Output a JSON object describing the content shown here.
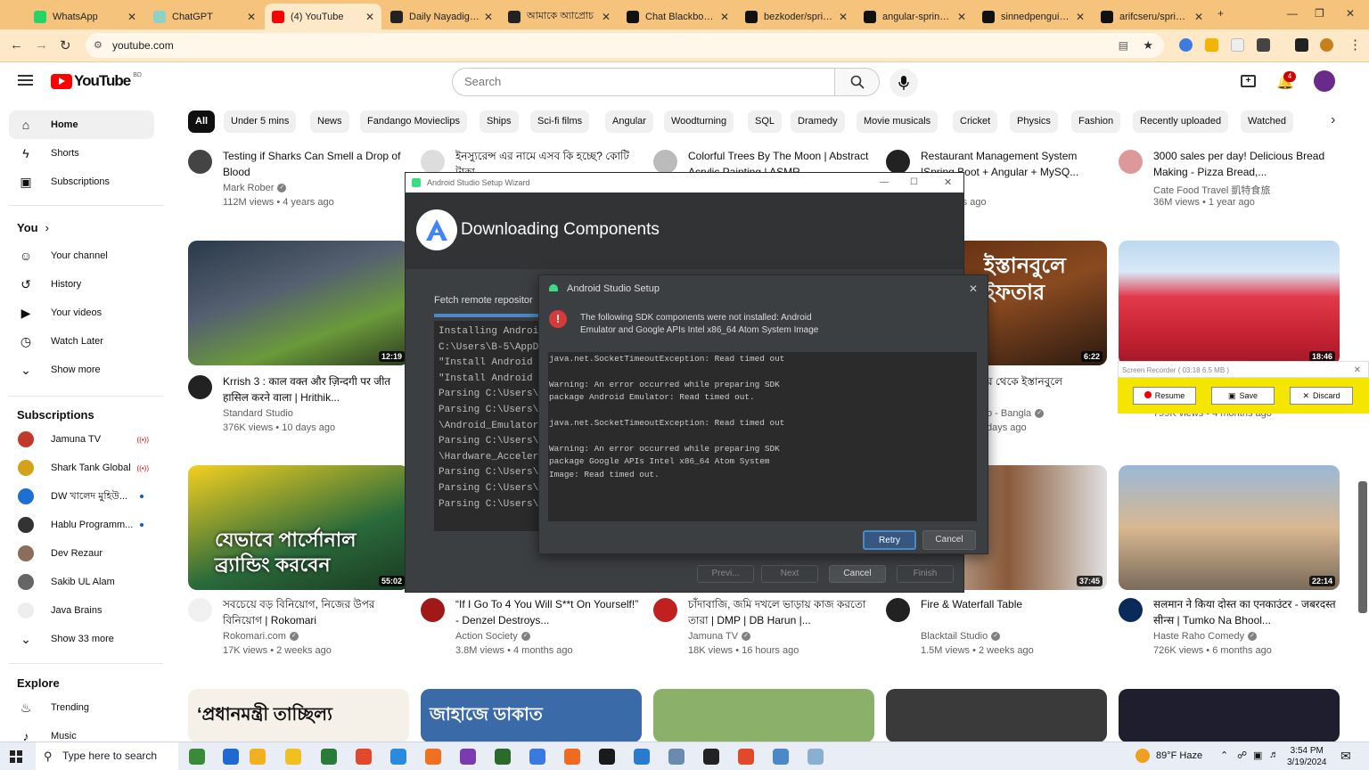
{
  "browser": {
    "tabs": [
      {
        "title": "WhatsApp",
        "color": "#25d366"
      },
      {
        "title": "ChatGPT",
        "color": "#8fd1c8"
      },
      {
        "title": "(4) YouTube",
        "color": "#ff0000"
      },
      {
        "title": "Daily Nayadiganta",
        "color": "#222222"
      },
      {
        "title": "আমাকে অ্যাপ্রোচ",
        "color": "#222222"
      },
      {
        "title": "Chat Blackbox: AI",
        "color": "#111111"
      },
      {
        "title": "bezkoder/spring-",
        "color": "#111111"
      },
      {
        "title": "angular-springbo",
        "color": "#111111"
      },
      {
        "title": "sinnedpenguin/ar",
        "color": "#111111"
      },
      {
        "title": "arifcseru/springb",
        "color": "#111111"
      }
    ],
    "new_tab": "+",
    "url": "youtube.com"
  },
  "youtube": {
    "logo_text": "YouTube",
    "region": "BD",
    "search_placeholder": "Search",
    "notif_count": "4"
  },
  "sidebar": {
    "main": [
      {
        "label": "Home",
        "icon": "home-icon"
      },
      {
        "label": "Shorts",
        "icon": "shorts-icon"
      },
      {
        "label": "Subscriptions",
        "icon": "subscriptions-icon"
      }
    ],
    "you_heading": "You",
    "you": [
      {
        "label": "Your channel"
      },
      {
        "label": "History"
      },
      {
        "label": "Your videos"
      },
      {
        "label": "Watch Later"
      },
      {
        "label": "Show more"
      }
    ],
    "subs_heading": "Subscriptions",
    "subs": [
      {
        "label": "Jamuna TV",
        "badge": "live",
        "color": "#c0392b"
      },
      {
        "label": "Shark Tank Global",
        "badge": "live",
        "color": "#d4a21a"
      },
      {
        "label": "DW খালেদ মুহিউ...",
        "badge": "dot",
        "color": "#1d6fd1"
      },
      {
        "label": "Hablu Programm...",
        "badge": "dot",
        "color": "#333333"
      },
      {
        "label": "Dev Rezaur",
        "badge": "",
        "color": "#8a6d5a"
      },
      {
        "label": "Sakib UL Alam",
        "badge": "",
        "color": "#666666"
      },
      {
        "label": "Java Brains",
        "badge": "",
        "color": "#eeeeee"
      },
      {
        "label": "Show 33 more",
        "badge": "",
        "color": ""
      }
    ],
    "explore_heading": "Explore",
    "explore": [
      {
        "label": "Trending"
      },
      {
        "label": "Music"
      }
    ]
  },
  "chips": [
    "All",
    "Under 5 mins",
    "News",
    "Fandango Movieclips",
    "Ships",
    "Sci-fi films",
    "Angular",
    "Woodturning",
    "SQL",
    "Dramedy",
    "Movie musicals",
    "Cricket",
    "Physics",
    "Fashion",
    "Recently uploaded",
    "Watched"
  ],
  "videos_top": [
    {
      "title": "Testing if Sharks Can Smell a Drop of Blood",
      "channel": "Mark Rober",
      "verified": true,
      "meta": "112M views • 4 years ago"
    },
    {
      "title": "ইনস্যুরেন্স এর নামে এসব কি হচ্ছে? কোটি টাকা...",
      "channel": "",
      "verified": false,
      "meta": ""
    },
    {
      "title": "Colorful Trees By The Moon | Abstract Acrylic Painting | ASMR",
      "channel": "",
      "verified": false,
      "meta": ""
    },
    {
      "title": "Restaurant Management System |Spring Boot + Angular + MySQ...",
      "channel": "Projects",
      "verified": false,
      "meta": "• 5 months ago"
    },
    {
      "title": "3000 sales per day! Delicious Bread Making - Pizza Bread,...",
      "channel": "Cate Food Travel 凱特食旅",
      "verified": false,
      "meta": "36M views • 1 year ago"
    }
  ],
  "videos_mid": [
    {
      "title": "Krrish 3 : काल वक्त और ज़िन्दगी पर जीत हासिल करने वाला | Hrithik...",
      "channel": "Standard Studio",
      "verified": false,
      "meta": "376K views • 10 days ago",
      "duration": "12:19"
    },
    {
      "title": "র থেকে ইস্তানবুলে",
      "channel": "o - Bangla",
      "verified": true,
      "meta": "days ago",
      "duration": "6:22"
    },
    {
      "title": "",
      "channel": "",
      "verified": false,
      "meta": "799K views • 4 months ago",
      "duration": "18:46"
    }
  ],
  "videos_bot": [
    {
      "title": "সবচেয়ে বড় বিনিয়োগ, নিজের উপর বিনিয়োগ | Rokomari",
      "channel": "Rokomari.com",
      "verified": true,
      "meta": "17K views • 2 weeks ago",
      "duration": "55:02"
    },
    {
      "title": "“If I Go To 4 You Will S**t On Yourself!” - Denzel Destroys...",
      "channel": "Action Society",
      "verified": true,
      "meta": "3.8M views • 4 months ago",
      "duration": ""
    },
    {
      "title": "চাঁদাবাজি, জমি দখলে ভাড়ায় কাজ করতো তারা | DMP | DB Harun |...",
      "channel": "Jamuna TV",
      "verified": true,
      "meta": "18K views • 16 hours ago",
      "duration": ""
    },
    {
      "title": "Fire & Waterfall Table",
      "channel": "Blacktail Studio",
      "verified": true,
      "meta": "1.5M views • 2 weeks ago",
      "duration": "37:45"
    },
    {
      "title": "सलमान ने किया दोस्त का एनकाउंटर - जबरदस्त सीन्स | Tumko Na Bhool...",
      "channel": "Haste Raho Comedy",
      "verified": true,
      "meta": "726K views • 6 months ago",
      "duration": "22:14"
    }
  ],
  "thumb_text": {
    "mid_bangla": "ইস্তানবুলে ইফতার",
    "bot_bangla": "যেভাবে পার্সোনাল ব্র্যান্ডিং করবেন",
    "row4_a": "‘প্রধানমন্ত্রী তাচ্ছিল্য",
    "row4_b": "জাহাজে ডাকাত"
  },
  "wizard": {
    "window_title": "Android Studio Setup Wizard",
    "heading": "Downloading Components",
    "fetch_label": "Fetch remote repositor",
    "log": [
      "Installing Android",
      "  C:\\Users\\B-5\\AppD",
      "\"Install Android S",
      "\"Install Android S",
      "Parsing C:\\Users\\B",
      "Parsing C:\\Users\\B",
      "  \\Android_Emulator",
      "Parsing C:\\Users\\B",
      "  \\Hardware_Acceler",
      "Parsing C:\\Users\\B",
      "Parsing C:\\Users\\B",
      "Parsing C:\\Users\\B"
    ],
    "buttons": {
      "prev": "Previ...",
      "next": "Next",
      "cancel": "Cancel",
      "finish": "Finish"
    }
  },
  "dialog": {
    "title": "Android Studio Setup",
    "message": "The following SDK components were not installed: Android Emulator and Google APIs Intel x86_64 Atom System Image",
    "log": "java.net.SocketTimeoutException: Read timed out\n\nWarning: An error occurred while preparing SDK\npackage Android Emulator: Read timed out.\n\njava.net.SocketTimeoutException: Read timed out\n\nWarning: An error occurred while preparing SDK\npackage Google APIs Intel x86_64 Atom System\nImage: Read timed out.",
    "retry": "Retry",
    "cancel": "Cancel"
  },
  "recorder": {
    "title": "Screen Recorder ( 03:18  6.5 MB )",
    "resume": "Resume",
    "save": "Save",
    "discard": "Discard"
  },
  "taskbar": {
    "search": "Type here to search",
    "weather": "89°F  Haze",
    "time": "3:54 PM",
    "date": "3/19/2024"
  }
}
